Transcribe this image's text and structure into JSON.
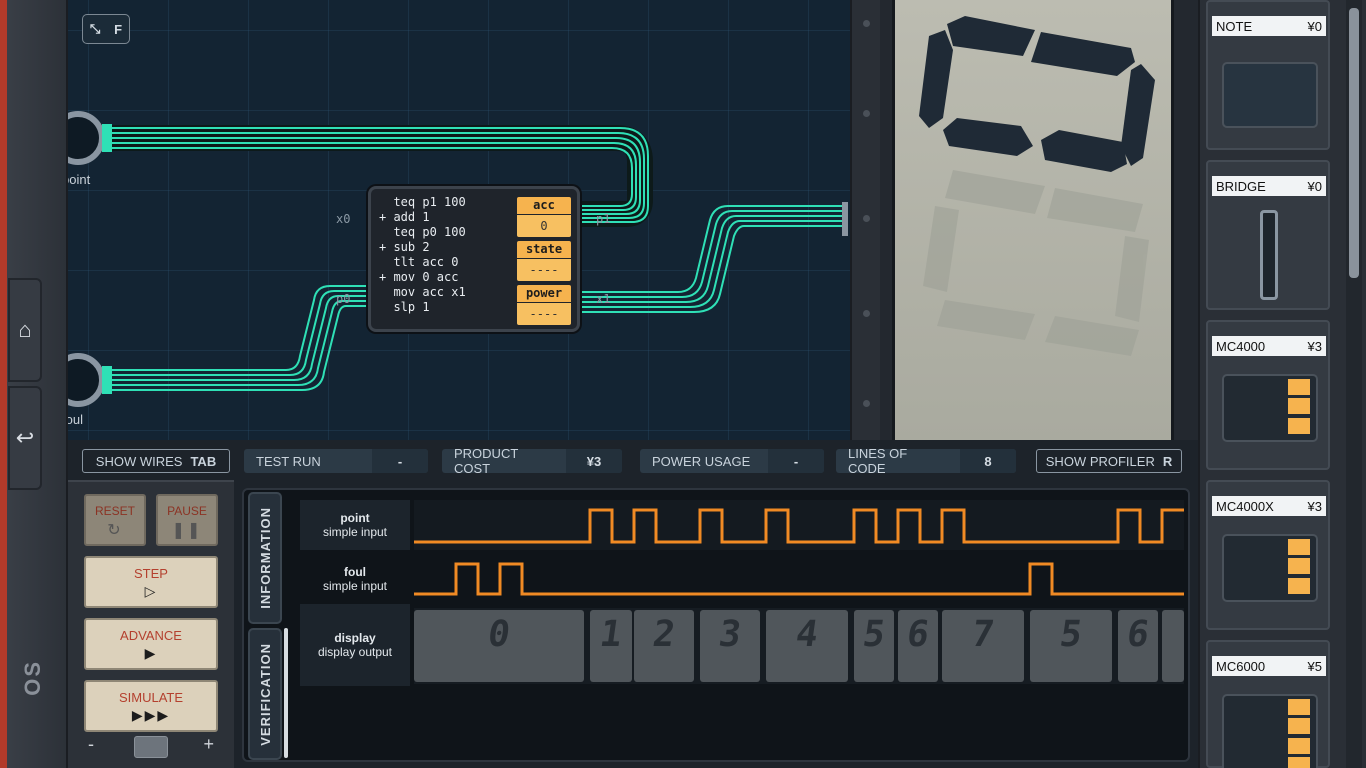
{
  "board": {
    "fullscreen_key": "F",
    "ports": {
      "point": "point",
      "foul": "foul"
    },
    "pins": {
      "x0": "x0",
      "p0": "p0",
      "p1": "p1",
      "x1": "x1"
    },
    "code_lines": [
      "  teq p1 100",
      "+ add 1",
      "  teq p0 100",
      "+ sub 2",
      "  tlt acc 0",
      "+ mov 0 acc",
      "  mov acc x1",
      "  slp 1"
    ],
    "registers": [
      {
        "name": "acc",
        "value": "0"
      },
      {
        "name": "state",
        "value": "----"
      },
      {
        "name": "power",
        "value": "----"
      }
    ]
  },
  "display": {
    "digit_value": 0
  },
  "stats": {
    "show_wires": "SHOW WIRES",
    "show_wires_key": "TAB",
    "test_run": "TEST RUN",
    "test_run_value": "-",
    "product_cost": "PRODUCT COST",
    "product_cost_value": "¥3",
    "power_usage": "POWER USAGE",
    "power_usage_value": "-",
    "lines_of_code": "LINES OF CODE",
    "lines_of_code_value": "8",
    "show_profiler": "SHOW PROFILER",
    "show_profiler_key": "R"
  },
  "controls": {
    "reset": "RESET",
    "pause": "PAUSE",
    "step": "STEP",
    "advance": "ADVANCE",
    "simulate": "SIMULATE",
    "minus": "-",
    "plus": "+"
  },
  "info": {
    "tabs": [
      "INFORMATION",
      "VERIFICATION"
    ],
    "tracks": [
      {
        "name": "point",
        "type": "simple input"
      },
      {
        "name": "foul",
        "type": "simple input"
      },
      {
        "name": "display",
        "type": "display output"
      }
    ],
    "display_digits": [
      "0",
      "1",
      "2",
      "3",
      "4",
      "5",
      "6",
      "7",
      "5",
      "6"
    ]
  },
  "parts": [
    {
      "name": "NOTE",
      "cost": "¥0"
    },
    {
      "name": "BRIDGE",
      "cost": "¥0"
    },
    {
      "name": "MC4000",
      "cost": "¥3"
    },
    {
      "name": "MC4000X",
      "cost": "¥3"
    },
    {
      "name": "MC6000",
      "cost": "¥5"
    }
  ],
  "colors": {
    "wire": "#2fe0b6",
    "register": "#f6b34e",
    "waveform": "#f08a24",
    "accent_red": "#b23a2a"
  }
}
